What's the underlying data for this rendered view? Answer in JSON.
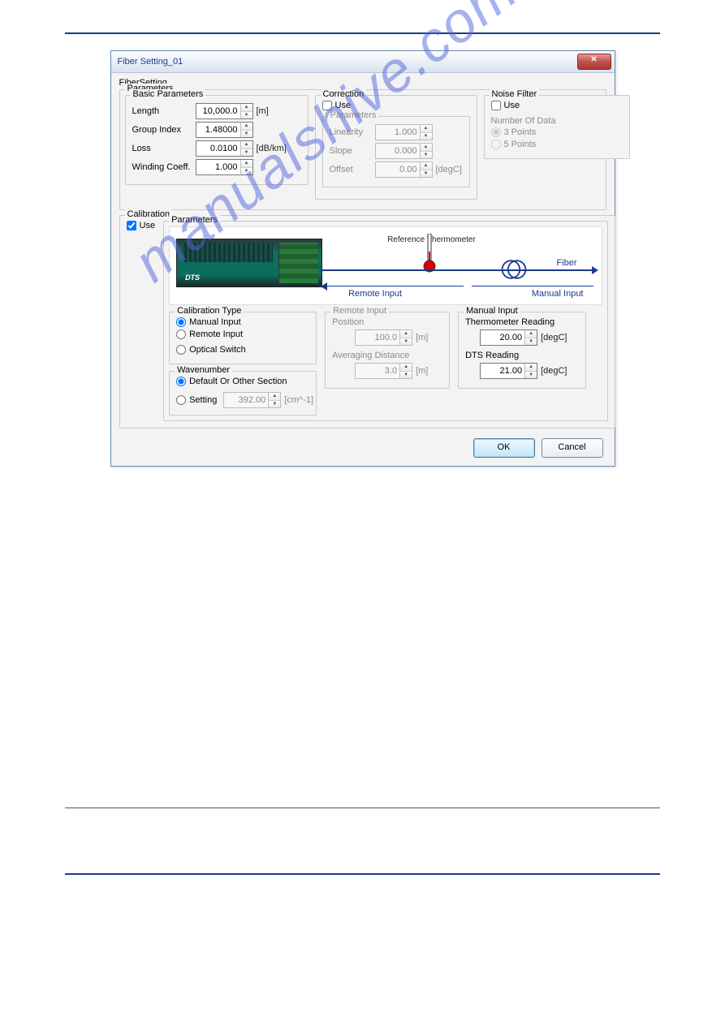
{
  "watermark": "manualshive.com",
  "dialog": {
    "title": "Fiber Setting_01",
    "close_glyph": "✕",
    "fibersetting_label": "FiberSetting",
    "parameters_label": "Parameters",
    "basic": {
      "legend": "Basic Parameters",
      "length_label": "Length",
      "length_value": "10,000.0",
      "length_unit": "[m]",
      "group_index_label": "Group Index",
      "group_index_value": "1.48000",
      "loss_label": "Loss",
      "loss_value": "0.0100",
      "loss_unit": "[dB/km]",
      "winding_label": "Winding Coeff.",
      "winding_value": "1.000"
    },
    "correction": {
      "legend": "Correction",
      "use_label": "Use",
      "use_checked": false,
      "params_label": "Parameters",
      "linearity_label": "Linearity",
      "linearity_value": "1.000",
      "slope_label": "Slope",
      "slope_value": "0.000",
      "offset_label": "Offset",
      "offset_value": "0.00",
      "offset_unit": "[degC]"
    },
    "noise": {
      "legend": "Noise Filter",
      "use_label": "Use",
      "use_checked": false,
      "num_label": "Number Of Data",
      "opt3_label": "3 Points",
      "opt3_selected": true,
      "opt5_label": "5 Points",
      "opt5_selected": false
    },
    "calibration": {
      "legend": "Calibration",
      "use_label": "Use",
      "use_checked": true,
      "params_label": "Parameters",
      "diagram": {
        "ref_therm": "Reference Thermometer",
        "fiber": "Fiber",
        "remote": "Remote Input",
        "manual": "Manual Input",
        "brand": "DTS"
      },
      "caltype": {
        "legend": "Calibration Type",
        "manual_label": "Manual Input",
        "manual_selected": true,
        "remote_label": "Remote Input",
        "remote_selected": false,
        "optsw_label": "Optical Switch",
        "optsw_selected": false
      },
      "wavenum": {
        "legend": "Wavenumber",
        "default_label": "Default Or Other Section",
        "default_selected": true,
        "setting_label": "Setting",
        "setting_selected": false,
        "setting_value": "392.00",
        "setting_unit": "[cm^-1]"
      },
      "remote": {
        "legend": "Remote Input",
        "pos_label": "Position",
        "pos_value": "100.0",
        "pos_unit": "[m]",
        "avg_label": "Averaging Distance",
        "avg_value": "3.0",
        "avg_unit": "[m]"
      },
      "manual": {
        "legend": "Manual Input",
        "therm_label": "Thermometer Reading",
        "therm_value": "20.00",
        "therm_unit": "[degC]",
        "dts_label": "DTS Reading",
        "dts_value": "21.00",
        "dts_unit": "[degC]"
      }
    },
    "ok_label": "OK",
    "cancel_label": "Cancel"
  }
}
